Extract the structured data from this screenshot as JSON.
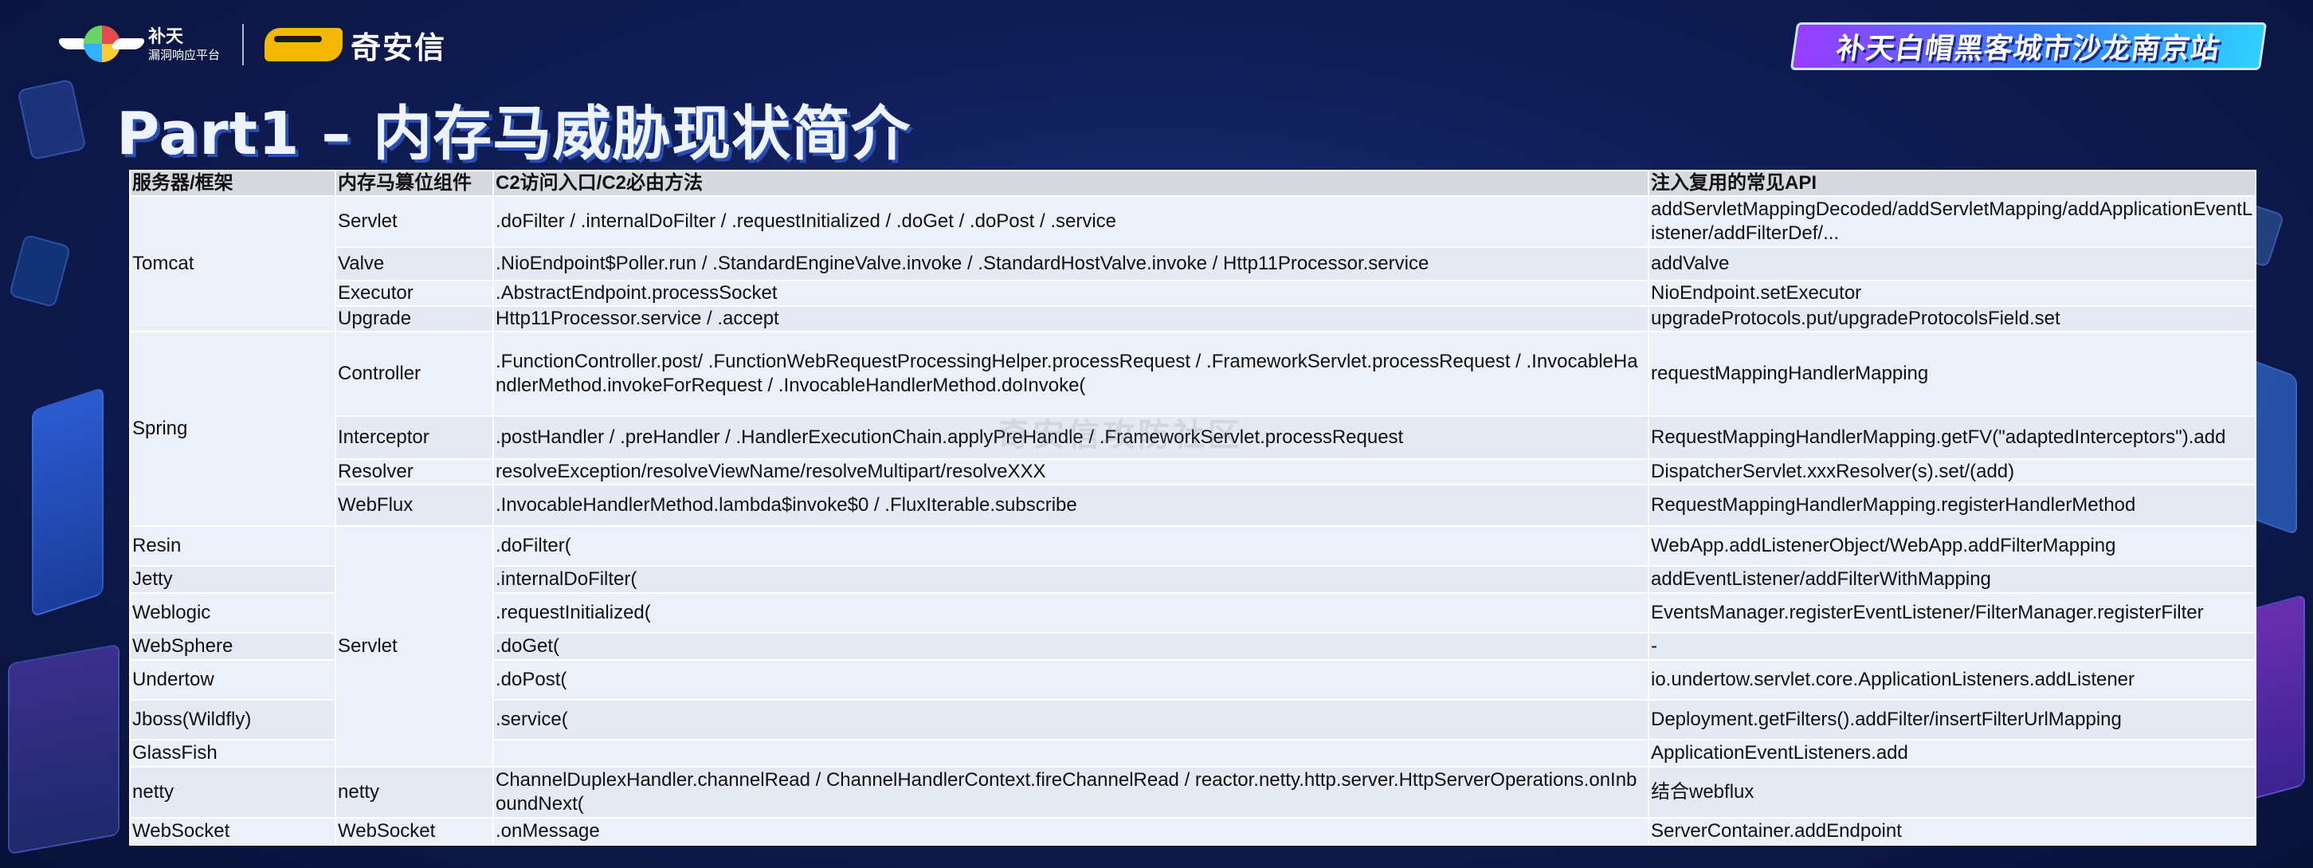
{
  "header": {
    "logo_line1": "补天",
    "logo_line2": "漏洞响应平台",
    "partner_name": "奇安信",
    "event_banner": "补天白帽黑客城市沙龙南京站"
  },
  "title": "Part1 – 内存马威胁现状简介",
  "watermark": "奇安信攻防社区",
  "table": {
    "headers": [
      "服务器/框架",
      "内存马篡位组件",
      "C2访问入口/C2必由方法",
      "注入复用的常见API"
    ],
    "tomcat": {
      "framework": "Tomcat",
      "rows": [
        {
          "component": "Servlet",
          "entry": ".doFilter / .internalDoFilter / .requestInitialized / .doGet / .doPost / .service",
          "api": "addServletMappingDecoded/addServletMapping/addApplicationEventListener/addFilterDef/..."
        },
        {
          "component": "Valve",
          "entry": ".NioEndpoint$Poller.run / .StandardEngineValve.invoke / .StandardHostValve.invoke / Http11Processor.service",
          "api": "addValve"
        },
        {
          "component": "Executor",
          "entry": ".AbstractEndpoint.processSocket",
          "api": "NioEndpoint.setExecutor"
        },
        {
          "component": "Upgrade",
          "entry": "Http11Processor.service / .accept",
          "api": "upgradeProtocols.put/upgradeProtocolsField.set"
        }
      ]
    },
    "spring": {
      "framework": "Spring",
      "rows": [
        {
          "component": "Controller",
          "entry": ".FunctionController.post/ .FunctionWebRequestProcessingHelper.processRequest / .FrameworkServlet.processRequest / .InvocableHandlerMethod.invokeForRequest / .InvocableHandlerMethod.doInvoke(",
          "api": "requestMappingHandlerMapping"
        },
        {
          "component": "Interceptor",
          "entry": ".postHandler / .preHandler / .HandlerExecutionChain.applyPreHandle / .FrameworkServlet.processRequest",
          "api": "RequestMappingHandlerMapping.getFV(\"adaptedInterceptors\").add"
        },
        {
          "component": "Resolver",
          "entry": "resolveException/resolveViewName/resolveMultipart/resolveXXX",
          "api": "DispatcherServlet.xxxResolver(s).set/(add)"
        },
        {
          "component": "WebFlux",
          "entry": ".InvocableHandlerMethod.lambda$invoke$0 / .FluxIterable.subscribe",
          "api": "RequestMappingHandlerMapping.registerHandlerMethod"
        }
      ]
    },
    "servlet_group": {
      "component": "Servlet",
      "rows": [
        {
          "framework": "Resin",
          "entry": ".doFilter(",
          "api": "WebApp.addListenerObject/WebApp.addFilterMapping"
        },
        {
          "framework": "Jetty",
          "entry": ".internalDoFilter(",
          "api": "addEventListener/addFilterWithMapping"
        },
        {
          "framework": "Weblogic",
          "entry": ".requestInitialized(",
          "api": "EventsManager.registerEventListener/FilterManager.registerFilter"
        },
        {
          "framework": "WebSphere",
          "entry": ".doGet(",
          "api": "-"
        },
        {
          "framework": "Undertow",
          "entry": ".doPost(",
          "api": "io.undertow.servlet.core.ApplicationListeners.addListener"
        },
        {
          "framework": "Jboss(Wildfly)",
          "entry": ".service(",
          "api": "Deployment.getFilters().addFilter/insertFilterUrlMapping"
        },
        {
          "framework": "GlassFish",
          "entry": "",
          "api": "ApplicationEventListeners.add"
        }
      ]
    },
    "netty": {
      "framework": "netty",
      "component": "netty",
      "entry": "ChannelDuplexHandler.channelRead / ChannelHandlerContext.fireChannelRead / reactor.netty.http.server.HttpServerOperations.onInboundNext(",
      "api": "结合webflux"
    },
    "websocket": {
      "framework": "WebSocket",
      "component": "WebSocket",
      "entry": ".onMessage",
      "api": "ServerContainer.addEndpoint"
    }
  }
}
